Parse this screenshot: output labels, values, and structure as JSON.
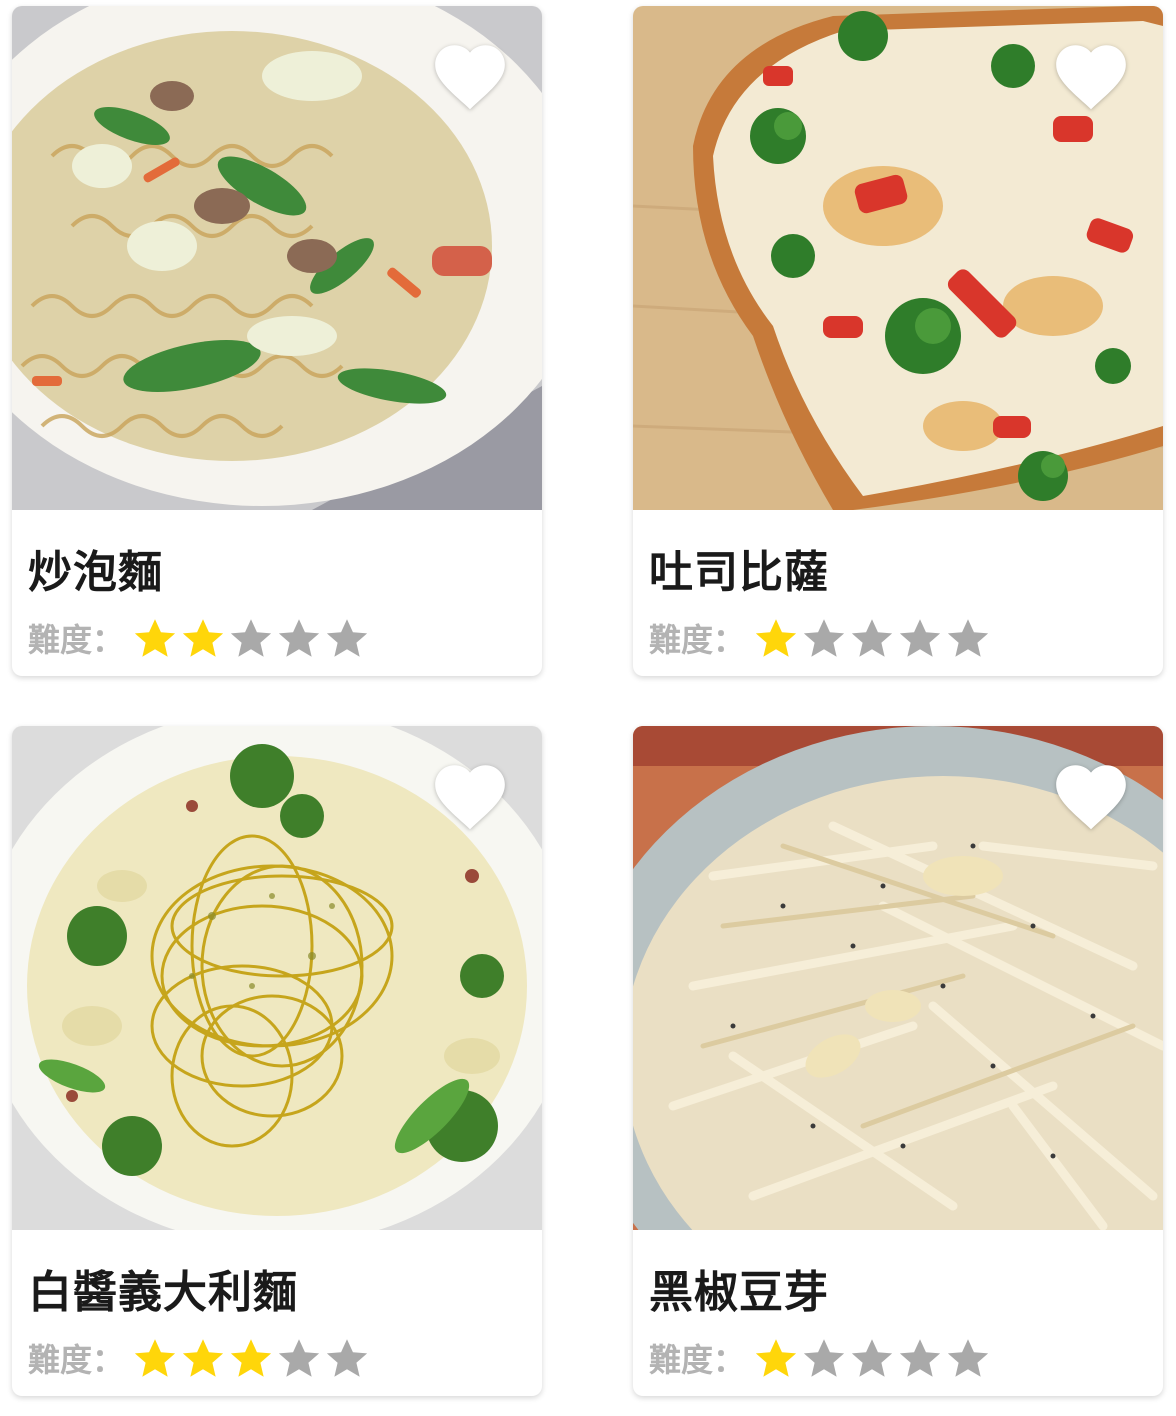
{
  "difficulty_label": "難度：",
  "colors": {
    "star_filled": "#ffd60a",
    "star_empty": "#a9a9a9",
    "heart": "#ffffff",
    "title": "#1a1a1a",
    "label": "#b3b3b3"
  },
  "recipes": [
    {
      "title": "炒泡麵",
      "difficulty": 2,
      "max_difficulty": 5,
      "photo": "stir-fried-instant-noodles-photo",
      "favorite_icon": "heart-icon"
    },
    {
      "title": "吐司比薩",
      "difficulty": 1,
      "max_difficulty": 5,
      "photo": "toast-pizza-photo",
      "favorite_icon": "heart-icon"
    },
    {
      "title": "白醬義大利麵",
      "difficulty": 3,
      "max_difficulty": 5,
      "photo": "cream-sauce-pasta-photo",
      "favorite_icon": "heart-icon"
    },
    {
      "title": "黑椒豆芽",
      "difficulty": 1,
      "max_difficulty": 5,
      "photo": "black-pepper-bean-sprouts-photo",
      "favorite_icon": "heart-icon"
    }
  ]
}
